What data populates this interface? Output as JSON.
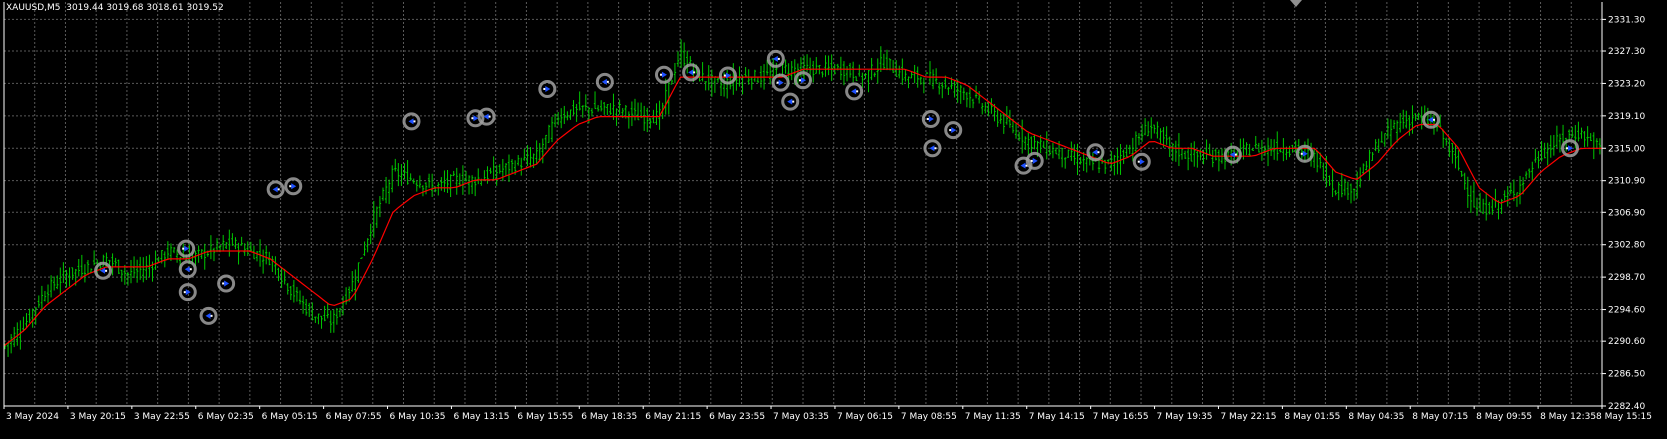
{
  "header": {
    "symbol_timeframe": "XAUUSD,M5",
    "ohlc": "3019.44 3019.68 3018.61 3019.52"
  },
  "colors": {
    "background": "#000000",
    "grid": "#5a5a5a",
    "candles": "#00c800",
    "moving_average": "#ff0000",
    "axis_text": "#ffffff",
    "marker_ring": "#a0a0a0",
    "marker_arrow": "#1e50ff"
  },
  "chart_data": {
    "type": "line",
    "title": "",
    "y_ticks": [
      "2331.30",
      "2327.30",
      "2323.20",
      "2319.10",
      "2315.00",
      "2310.90",
      "2306.90",
      "2302.80",
      "2298.70",
      "2294.60",
      "2290.60",
      "2286.50",
      "2282.40"
    ],
    "x_ticks": [
      "3 May 2024",
      "3 May 20:15",
      "3 May 22:55",
      "6 May 02:35",
      "6 May 05:15",
      "6 May 07:55",
      "6 May 10:35",
      "6 May 13:15",
      "6 May 15:55",
      "6 May 18:35",
      "6 May 21:15",
      "6 May 23:55",
      "7 May 03:35",
      "7 May 06:15",
      "7 May 08:55",
      "7 May 11:35",
      "7 May 14:15",
      "7 May 16:55",
      "7 May 19:35",
      "7 May 22:15",
      "8 May 01:55",
      "8 May 04:35",
      "8 May 07:15",
      "8 May 09:55",
      "8 May 12:35",
      "8 May 15:15"
    ],
    "ylim": [
      2282.4,
      2333.5
    ],
    "grid": true,
    "series": [
      {
        "values": [
          2290,
          2293,
          2297,
          2299,
          2300,
          2301,
          2299,
          2300,
          2302,
          2301,
          2302,
          2303,
          2302,
          2301,
          2297,
          2294,
          2293,
          2298,
          2306,
          2312,
          2311,
          2310,
          2311,
          2311,
          2312,
          2313,
          2314,
          2319,
          2320,
          2320,
          2320,
          2319,
          2319,
          2327,
          2324,
          2323,
          2324,
          2324,
          2325,
          2325,
          2325,
          2325,
          2324,
          2326,
          2324,
          2324,
          2323,
          2322,
          2320,
          2318,
          2316,
          2315,
          2314,
          2313,
          2313,
          2315,
          2318,
          2315,
          2314,
          2314,
          2314,
          2315,
          2315,
          2315,
          2314,
          2310,
          2310,
          2315,
          2318,
          2319,
          2318,
          2313,
          2307,
          2308,
          2310,
          2314,
          2316,
          2317,
          2315
        ]
      },
      {
        "values": [
          2290,
          2292,
          2295,
          2297,
          2299,
          2300,
          2300,
          2300,
          2301,
          2301,
          2302,
          2302,
          2302,
          2301,
          2299,
          2297,
          2295,
          2296,
          2301,
          2307,
          2309,
          2310,
          2310,
          2311,
          2311,
          2312,
          2313,
          2316,
          2318,
          2319,
          2319,
          2319,
          2319,
          2324,
          2324,
          2324,
          2324,
          2324,
          2324,
          2325,
          2325,
          2325,
          2325,
          2325,
          2325,
          2324,
          2324,
          2323,
          2321,
          2319,
          2317,
          2316,
          2315,
          2314,
          2313,
          2314,
          2316,
          2315,
          2315,
          2314,
          2314,
          2314,
          2315,
          2315,
          2315,
          2312,
          2311,
          2313,
          2316,
          2318,
          2318,
          2315,
          2310,
          2308,
          2309,
          2312,
          2314,
          2315,
          2315
        ]
      }
    ]
  },
  "markers": [
    {
      "t": 0.062,
      "p": 2299.5
    },
    {
      "t": 0.114,
      "p": 2302.3
    },
    {
      "t": 0.115,
      "p": 2299.7
    },
    {
      "t": 0.115,
      "p": 2296.8
    },
    {
      "t": 0.128,
      "p": 2293.8
    },
    {
      "t": 0.139,
      "p": 2297.9
    },
    {
      "t": 0.17,
      "p": 2309.8
    },
    {
      "t": 0.181,
      "p": 2310.2
    },
    {
      "t": 0.255,
      "p": 2318.4
    },
    {
      "t": 0.295,
      "p": 2318.8
    },
    {
      "t": 0.302,
      "p": 2319.0
    },
    {
      "t": 0.34,
      "p": 2322.5
    },
    {
      "t": 0.376,
      "p": 2323.4
    },
    {
      "t": 0.413,
      "p": 2324.3
    },
    {
      "t": 0.43,
      "p": 2324.6
    },
    {
      "t": 0.453,
      "p": 2324.2
    },
    {
      "t": 0.483,
      "p": 2326.3
    },
    {
      "t": 0.486,
      "p": 2323.3
    },
    {
      "t": 0.492,
      "p": 2320.9
    },
    {
      "t": 0.5,
      "p": 2323.6
    },
    {
      "t": 0.532,
      "p": 2322.2
    },
    {
      "t": 0.58,
      "p": 2318.7
    },
    {
      "t": 0.581,
      "p": 2315.0
    },
    {
      "t": 0.594,
      "p": 2317.3
    },
    {
      "t": 0.638,
      "p": 2312.8
    },
    {
      "t": 0.645,
      "p": 2313.4
    },
    {
      "t": 0.683,
      "p": 2314.5
    },
    {
      "t": 0.712,
      "p": 2313.3
    },
    {
      "t": 0.769,
      "p": 2314.2
    },
    {
      "t": 0.814,
      "p": 2314.3
    },
    {
      "t": 0.893,
      "p": 2318.6
    },
    {
      "t": 0.98,
      "p": 2315.0
    }
  ]
}
